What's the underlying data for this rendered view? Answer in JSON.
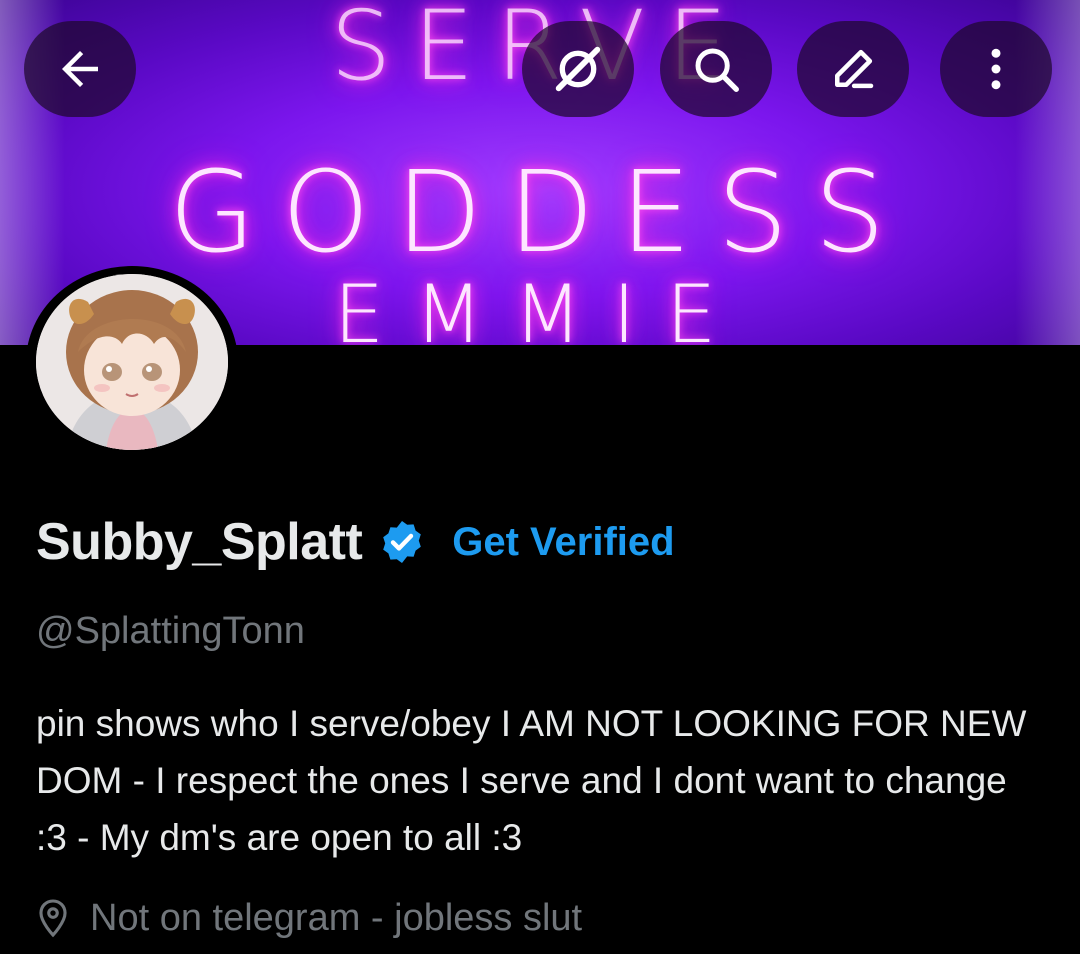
{
  "banner": {
    "line1": "SERVE",
    "line2": "GODDESS",
    "line3": "EMMIE"
  },
  "toolbar": {
    "back_icon": "arrow-left-icon",
    "grok_icon": "grok-icon",
    "search_icon": "search-icon",
    "edit_icon": "pencil-icon",
    "more_icon": "more-vertical-icon"
  },
  "profile": {
    "display_name": "Subby_Splatt",
    "verified_badge": "verified-badge-icon",
    "get_verified_label": "Get Verified",
    "handle": "@SplattingTonn",
    "bio": "pin shows who I serve/obey I AM NOT LOOKING FOR NEW DOM - I respect the ones I serve and I dont want to change :3 - My dm's are open to all :3",
    "location_icon": "location-pin-icon",
    "location": "Not on telegram - jobless slut"
  },
  "colors": {
    "background": "#000000",
    "primary_text": "#e7e9ea",
    "secondary_text": "#71767b",
    "accent": "#1d9bf0",
    "banner_purple": "#7c16ee",
    "neon_pink": "#ff2fe6"
  }
}
